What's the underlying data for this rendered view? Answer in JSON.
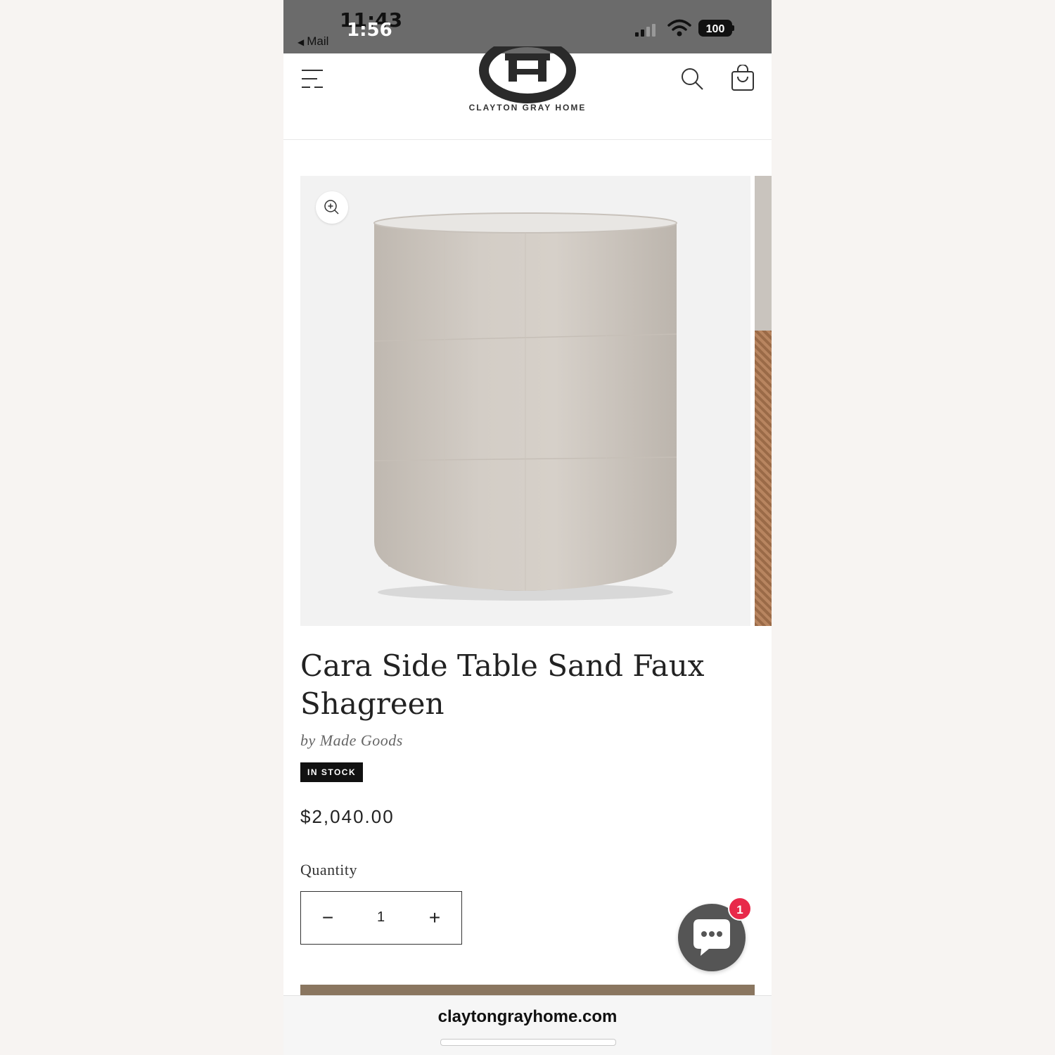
{
  "status_bar": {
    "time": "11:43",
    "time_overlay": "1:56",
    "back_label": "Mail",
    "battery": "100"
  },
  "header": {
    "brand": "CLAYTON GRAY HOME",
    "menu_icon": "menu-icon",
    "search_icon": "search-icon",
    "cart_icon": "cart-icon"
  },
  "product": {
    "title": "Cara Side Table Sand Faux Shagreen",
    "vendor": "by Made Goods",
    "stock_badge": "IN STOCK",
    "price": "$2,040.00",
    "quantity_label": "Quantity",
    "quantity_value": "1",
    "minus": "−",
    "plus": "+"
  },
  "chat": {
    "icon": "chat-bubble-icon",
    "unread_count": "1"
  },
  "browser": {
    "url": "claytongrayhome.com"
  },
  "colors": {
    "status_bar": "#6b6b6b",
    "badge_bg": "#111111",
    "chat_bg": "#555555",
    "chat_badge": "#e8294a",
    "add_to_cart": "#8a7660"
  }
}
